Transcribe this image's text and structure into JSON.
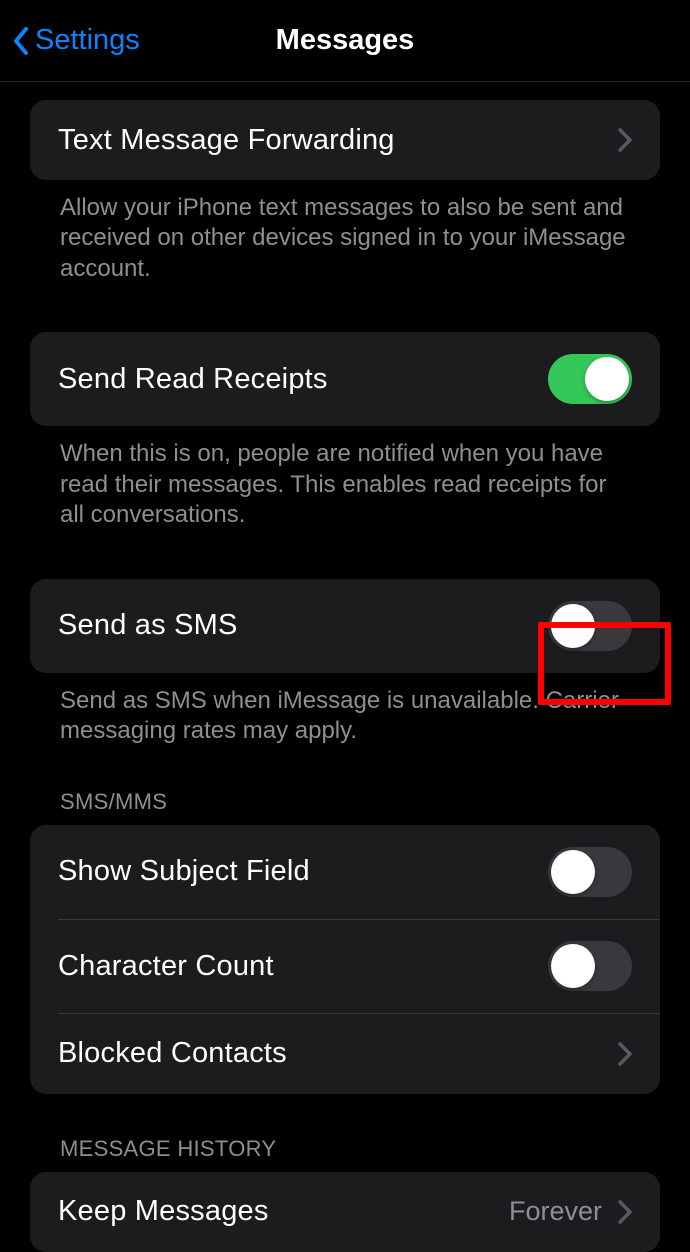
{
  "header": {
    "back_label": "Settings",
    "title": "Messages"
  },
  "sections": {
    "text_forward": {
      "label": "Text Message Forwarding",
      "footer": "Allow your iPhone text messages to also be sent and received on other devices signed in to your iMessage account."
    },
    "read_receipts": {
      "label": "Send Read Receipts",
      "toggle_on": true,
      "footer": "When this is on, people are notified when you have read their messages. This enables read receipts for all conversations."
    },
    "send_sms": {
      "label": "Send as SMS",
      "toggle_on": false,
      "footer": "Send as SMS when iMessage is unavailable. Carrier messaging rates may apply."
    },
    "sms_mms": {
      "header": "SMS/MMS",
      "subject_field": {
        "label": "Show Subject Field",
        "toggle_on": false
      },
      "char_count": {
        "label": "Character Count",
        "toggle_on": false
      },
      "blocked": {
        "label": "Blocked Contacts"
      }
    },
    "history": {
      "header": "MESSAGE HISTORY",
      "keep": {
        "label": "Keep Messages",
        "value": "Forever"
      }
    }
  }
}
